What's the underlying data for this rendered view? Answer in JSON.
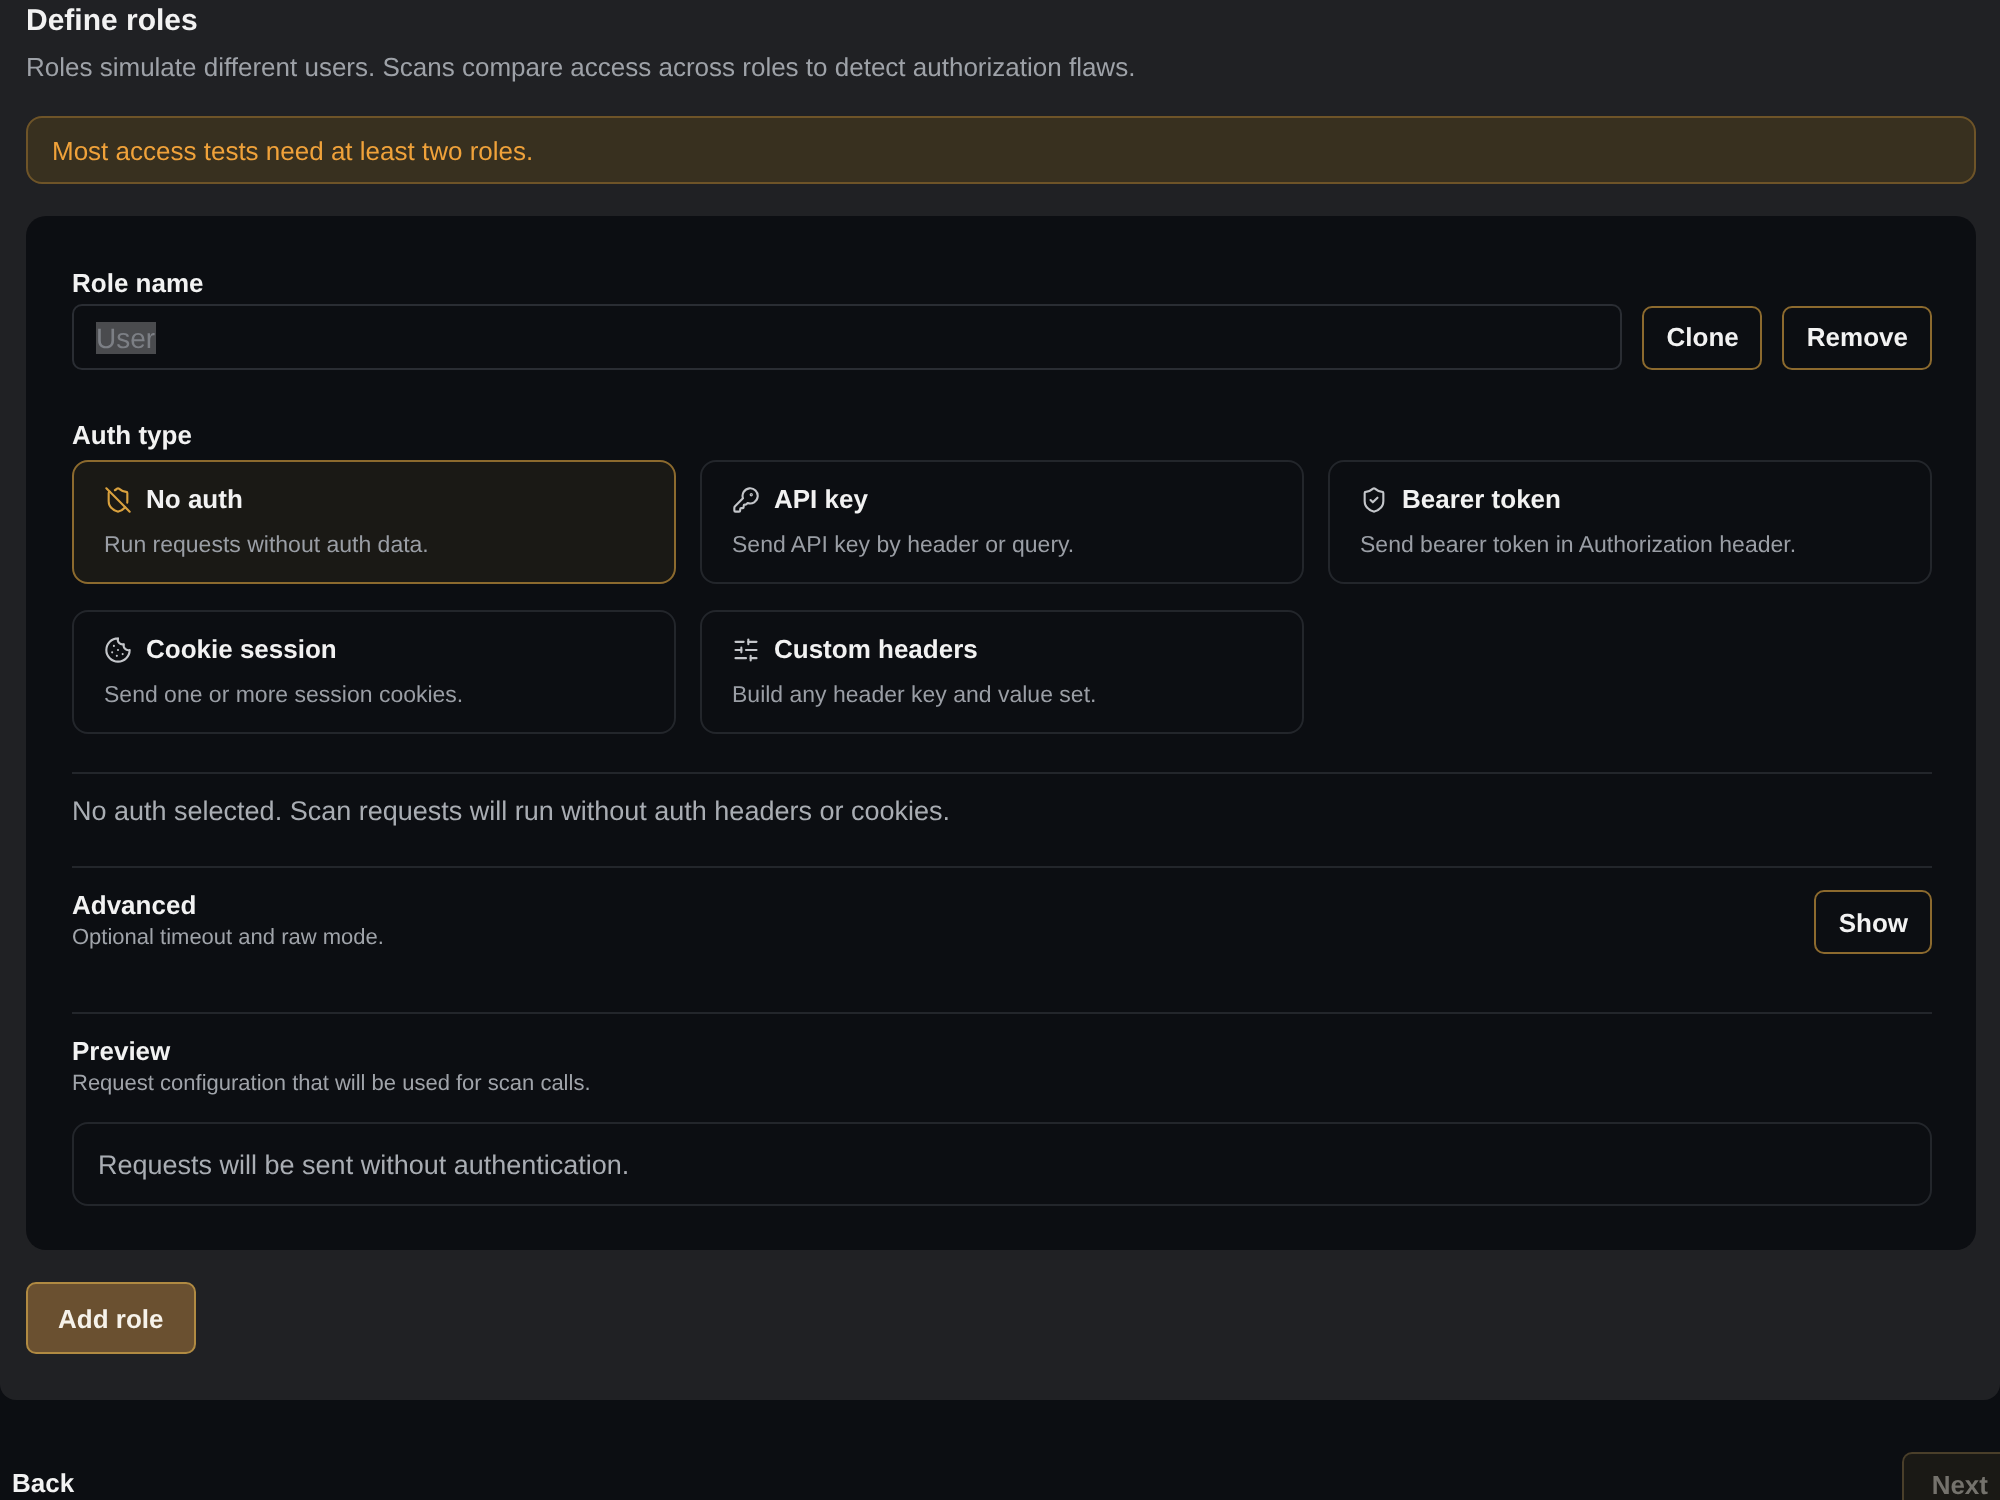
{
  "header": {
    "title": "Define roles",
    "subtitle": "Roles simulate different users. Scans compare access across roles to detect authorization flaws."
  },
  "notice": {
    "text": "Most access tests need at least two roles."
  },
  "role": {
    "name_label": "Role name",
    "name_value": "User",
    "name_text_selected": true,
    "actions": [
      {
        "label": "Clone"
      },
      {
        "label": "Remove"
      }
    ],
    "auth_label": "Auth type",
    "auth_options": [
      {
        "kind": "none",
        "title": "No auth",
        "description": "Run requests without auth data.",
        "selected": true
      },
      {
        "kind": "api_key",
        "title": "API key",
        "description": "Send API key by header or query.",
        "selected": false
      },
      {
        "kind": "bearer",
        "title": "Bearer token",
        "description": "Send bearer token in Authorization header.",
        "selected": false
      },
      {
        "kind": "cookie",
        "title": "Cookie session",
        "description": "Send one or more session cookies.",
        "selected": false
      },
      {
        "kind": "headers",
        "title": "Custom headers",
        "description": "Build any header key and value set.",
        "selected": false
      }
    ],
    "auth_status": "No auth selected. Scan requests will run without auth headers or cookies.",
    "advanced": {
      "title": "Advanced",
      "description": "Optional timeout and raw mode.",
      "button": "Show"
    },
    "preview": {
      "title": "Preview",
      "description": "Request configuration that will be used for scan calls.",
      "text": "Requests will be sent without authentication."
    }
  },
  "add_role_button": "Add role",
  "footer": {
    "back": "Back",
    "next": {
      "label": "Next",
      "disabled": true
    }
  }
}
